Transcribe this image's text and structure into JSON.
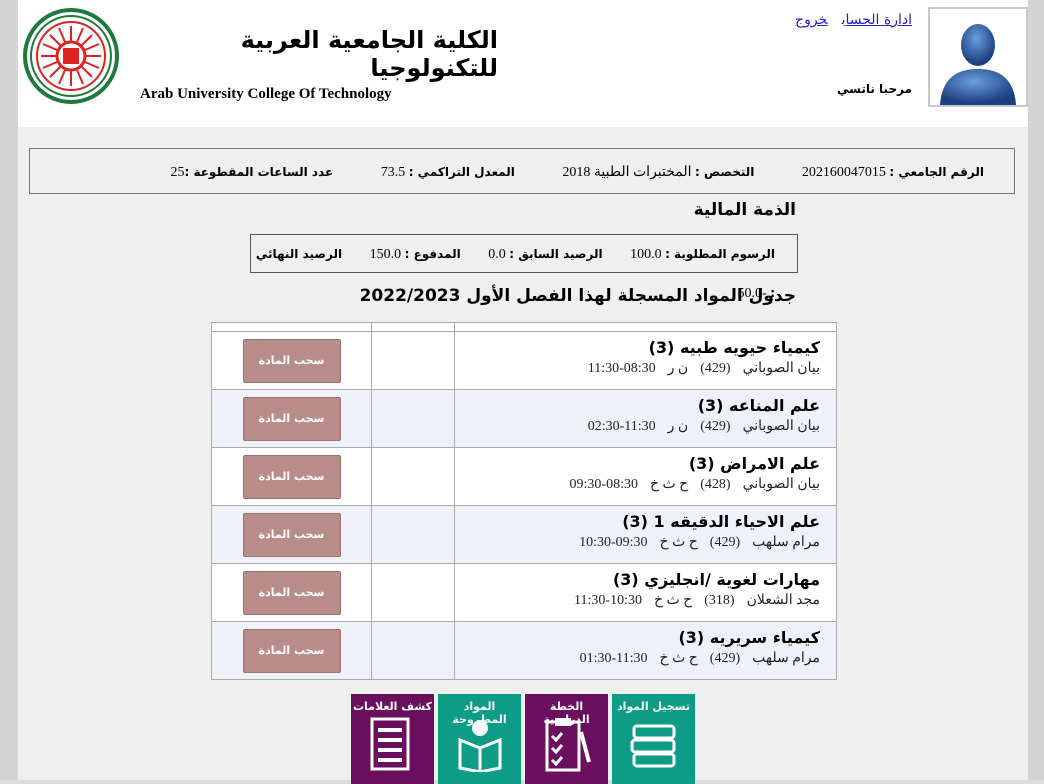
{
  "header": {
    "title_ar": "الكلية الجامعية العربية للتكنولوجيا",
    "title_en": "Arab University College Of Technology",
    "manage_account": "ادارة الحساب",
    "logout": "خروج",
    "welcome": "مرحبا ناتسي"
  },
  "student": {
    "id_label": "الرقم الجامعي :",
    "id_value": "202160047015",
    "major_label": "التخصص :",
    "major_value": "المختبرات الطبية 2018",
    "gpa_label": "المعدل التراكمي :",
    "gpa_value": "73.5",
    "hours_label": "عدد الساعات المقطوعة :",
    "hours_value": "25"
  },
  "finance": {
    "title": "الذمة المالية",
    "fees_label": "الرسوم المطلوبة :",
    "fees_value": "100.0",
    "prev_label": "الرصيد السابق :",
    "prev_value": "0.0",
    "paid_label": "المدفوع :",
    "paid_value": "150.0",
    "final_label": "الرصيد النهائي :",
    "final_value": "-50.0"
  },
  "schedule": {
    "title": "جدول المواد المسجلة لهذا الفصل الأول 2022/2023",
    "drop_label": "سحب المادة",
    "courses": [
      {
        "name": "كيمياء حيويه طبيه",
        "credits": "(3)",
        "instructor": "بيان الصوباني",
        "room": "(429)",
        "days": "ن ر",
        "time": "08:30-11:30"
      },
      {
        "name": "علم المناعه",
        "credits": "(3)",
        "instructor": "بيان الصوباني",
        "room": "(429)",
        "days": "ن ر",
        "time": "11:30-02:30"
      },
      {
        "name": "علم الامراض",
        "credits": "(3)",
        "instructor": "بيان الصوباني",
        "room": "(428)",
        "days": "ح ث خ",
        "time": "08:30-09:30"
      },
      {
        "name": "علم الاحياء الدقيقه 1",
        "credits": "(3)",
        "instructor": "مرام سلهب",
        "room": "(429)",
        "days": "ح ث خ",
        "time": "09:30-10:30"
      },
      {
        "name": "مهارات لغوية /انجليزي",
        "credits": "(3)",
        "instructor": "مجد الشعلان",
        "room": "(318)",
        "days": "ح ث خ",
        "time": "10:30-11:30"
      },
      {
        "name": "كيمياء سريريه",
        "credits": "(3)",
        "instructor": "مرام سلهب",
        "room": "(429)",
        "days": "ح ث خ",
        "time": "11:30-01:30"
      }
    ]
  },
  "tiles": [
    {
      "label": "كشف العلامات",
      "icon": "report-icon",
      "color": "#6a0e5e"
    },
    {
      "label": "المواد المطروحة",
      "icon": "book-reader-icon",
      "color": "#0d9d86"
    },
    {
      "label": "الخطة الدراسية",
      "icon": "checklist-icon",
      "color": "#6a0e5e"
    },
    {
      "label": "تسجيل المواد",
      "icon": "books-stack-icon",
      "color": "#0d9d86"
    }
  ]
}
